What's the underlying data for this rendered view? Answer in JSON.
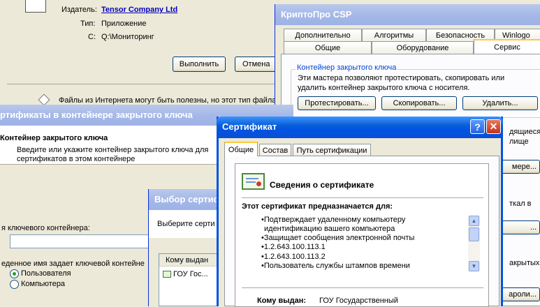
{
  "run_dialog": {
    "publisher_label": "Издатель:",
    "publisher_value": "Tensor Company Ltd",
    "type_label": "Тип:",
    "type_value": "Приложение",
    "from_label": "С:",
    "from_value": "Q:\\Мониторинг",
    "run_button": "Выполнить",
    "cancel_button": "Отмена",
    "warning_text": "Файлы из Интернета могут быть полезны, но этот тип файла"
  },
  "cryptopro": {
    "title": "КриптоПро CSP",
    "tabs_back": [
      "Дополнительно",
      "Алгоритмы",
      "Безопасность",
      "Winlogo"
    ],
    "tabs_front": [
      "Общие",
      "Оборудование",
      "Сервис"
    ],
    "active_tab": "Сервис",
    "group_title": "Контейнер закрытого ключа",
    "group_text_1": "Эти мастера позволяют протестировать, скопировать или",
    "group_text_2": "удалить контейнер закрытого ключа с носителя.",
    "test_button": "Протестировать...",
    "copy_button": "Скопировать...",
    "delete_button": "Удалить...",
    "right_snip_1": "дящиеся",
    "right_snip_2": "лище",
    "right_btn_1": "мере...",
    "right_snip_3": "ткал в",
    "right_btn_2": "...",
    "right_snip_4": "акрытых",
    "right_btn_3": "ароли..."
  },
  "certs_in_container": {
    "title": "ртификаты в контейнере закрытого ключа",
    "heading": "Контейнер закрытого ключа",
    "desc_1": "Введите или укажите контейнер закрытого ключа для",
    "desc_2": "сертификатов в этом контейнере",
    "name_label": "я ключевого контейнера:",
    "name_value": "",
    "name_type_label": "еденное имя задает ключевой контейне",
    "radio_user": "Пользователя",
    "radio_computer": "Компьютера",
    "user_checked": true
  },
  "cert_select": {
    "title": "Выбор сертиф",
    "prompt": "Выберите серти",
    "col_issued_to": "Кому выдан",
    "row_1": "ГОУ Гос..."
  },
  "certificate": {
    "title": "Сертификат",
    "tabs": [
      "Общие",
      "Состав",
      "Путь сертификации"
    ],
    "active_tab": "Общие",
    "info_heading": "Сведения о сертификате",
    "purpose_heading": "Этот сертификат предназначается для:",
    "purposes": [
      "•Подтверждает удаленному компьютеру",
      "идентификацию вашего компьютера",
      "•Защищает сообщения электронной почты",
      "•1.2.643.100.113.1",
      "•1.2.643.100.113.2",
      "•Пользователь службы штампов времени"
    ],
    "issued_to_label": "Кому выдан:",
    "issued_to_value": "ГОУ Государственный"
  },
  "colors": {
    "xp_title_blue": "#0054e3",
    "dialog_face": "#ece9d8",
    "close_red": "#e0441e"
  }
}
